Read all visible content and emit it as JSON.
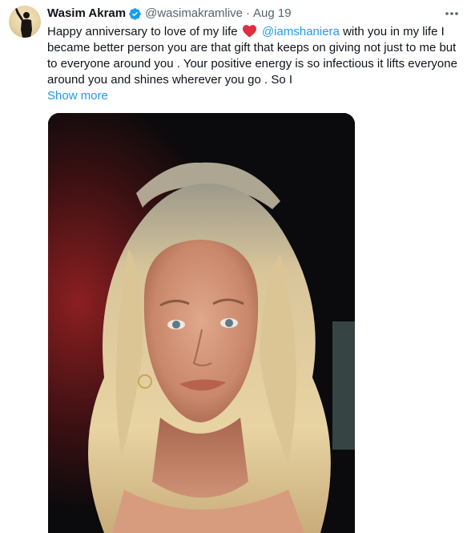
{
  "tweet": {
    "author": {
      "display_name": "Wasim Akram",
      "verified_icon": "verified-badge-icon",
      "handle": "@wasimakramlive",
      "separator": "·",
      "date": "Aug 19",
      "avatar_icon": "avatar"
    },
    "more_icon": "more-options-icon",
    "text": {
      "part1": "Happy anniversary to love of my life",
      "heart_icon": "red-heart-emoji",
      "mention": "@iamshaniera",
      "part2": "with you in my life I became better person you are that gift that keeps on giving not just to me but to everyone around you . Your positive energy is so infectious it lifts everyone around you and shines wherever you go . So I"
    },
    "show_more_label": "Show more",
    "media_icon": "photo"
  },
  "colors": {
    "link": "#1d9bf0",
    "text": "#0f1419",
    "secondary": "#536471",
    "heart": "#e0245e"
  }
}
